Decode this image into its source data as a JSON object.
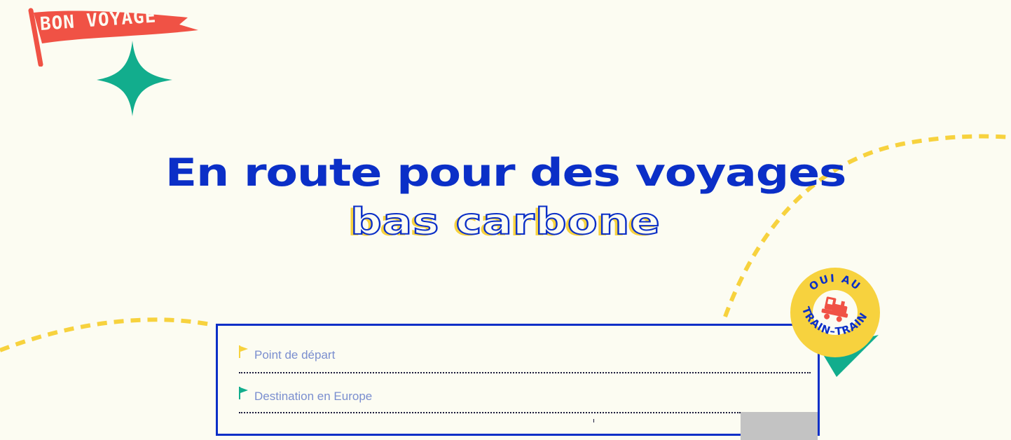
{
  "decor": {
    "flag_text": "BON VOYAGE",
    "badge_text": "OUI AU TRAIN-TRAIN",
    "star_icon": "four-point-star-icon",
    "train_icon": "train-icon"
  },
  "hero": {
    "title": "En route pour des voyages",
    "subtitle": "bas carbone"
  },
  "search": {
    "departure": {
      "placeholder": "Point de départ",
      "value": "",
      "flag_icon": "yellow-flag-icon"
    },
    "destination": {
      "placeholder": "Destination en Europe",
      "value": "",
      "flag_icon": "green-flag-icon"
    },
    "submit_icon": "submit-button"
  },
  "colors": {
    "background": "#fcfcf2",
    "primary_blue": "#0b2fc7",
    "flag_red": "#f05245",
    "star_green": "#12ad8d",
    "accent_yellow": "#f7d23e",
    "placeholder_blue": "#7a8ecf",
    "button_gray": "#c3c3c3"
  }
}
